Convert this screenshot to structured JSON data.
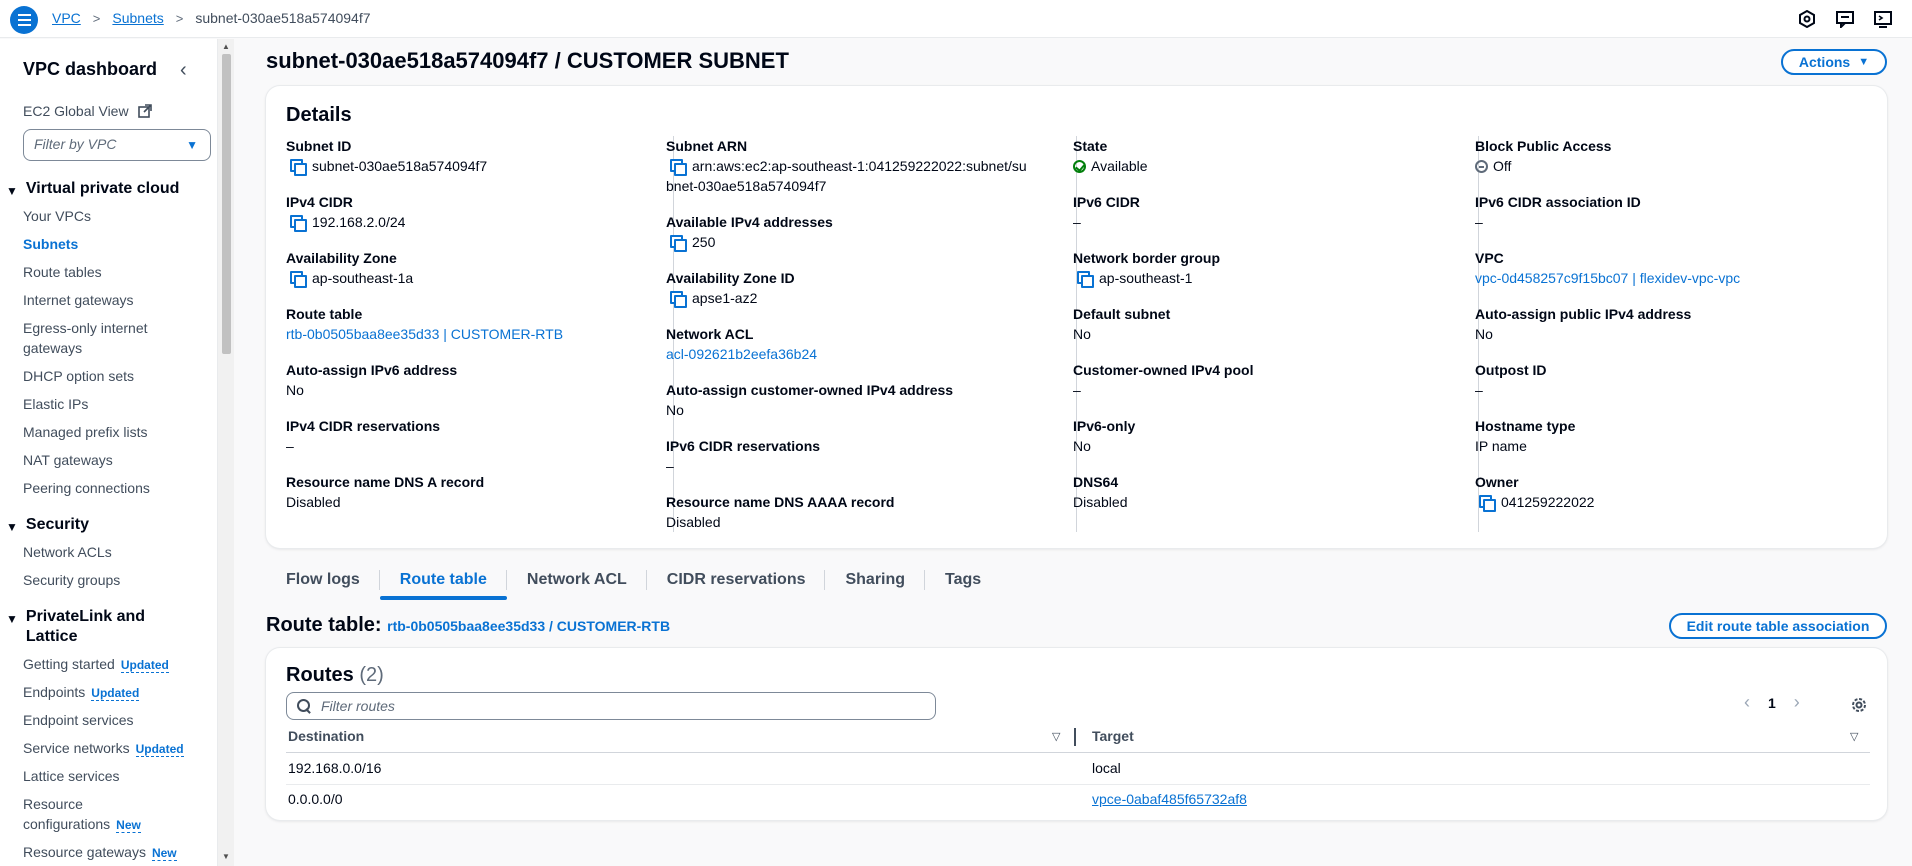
{
  "breadcrumb": {
    "items": [
      "VPC",
      "Subnets"
    ],
    "current": "subnet-030ae518a574094f7"
  },
  "sidebar": {
    "title": "VPC dashboard",
    "ec2_global_view": "EC2 Global View",
    "filter_placeholder": "Filter by VPC",
    "sections": [
      {
        "title": "Virtual private cloud"
      },
      {
        "title": "Security"
      },
      {
        "title": "PrivateLink and Lattice"
      }
    ],
    "vpc_items": [
      "Your VPCs",
      "Subnets",
      "Route tables",
      "Internet gateways",
      "Egress-only internet gateways",
      "DHCP option sets",
      "Elastic IPs",
      "Managed prefix lists",
      "NAT gateways",
      "Peering connections"
    ],
    "security_items": [
      "Network ACLs",
      "Security groups"
    ],
    "privatelink_items": [
      {
        "label": "Getting started",
        "badge": "Updated"
      },
      {
        "label": "Endpoints",
        "badge": "Updated"
      },
      {
        "label": "Endpoint services",
        "badge": ""
      },
      {
        "label": "Service networks",
        "badge": "Updated"
      },
      {
        "label": "Lattice services",
        "badge": ""
      },
      {
        "label": "Resource configurations",
        "badge": "New"
      },
      {
        "label": "Resource gateways",
        "badge": "New"
      }
    ]
  },
  "page": {
    "title": "subnet-030ae518a574094f7 / CUSTOMER SUBNET",
    "actions_label": "Actions"
  },
  "details": {
    "heading": "Details",
    "col1": [
      {
        "key": "Subnet ID",
        "value": "subnet-030ae518a574094f7"
      },
      {
        "key": "IPv4 CIDR",
        "value": "192.168.2.0/24"
      },
      {
        "key": "Availability Zone",
        "value": "ap-southeast-1a"
      },
      {
        "key": "Route table",
        "value": "rtb-0b0505baa8ee35d33 | CUSTOMER-RTB"
      },
      {
        "key": "Auto-assign IPv6 address",
        "value": "No"
      },
      {
        "key": "IPv4 CIDR reservations",
        "value": "–"
      },
      {
        "key": "Resource name DNS A record",
        "value": "Disabled"
      }
    ],
    "col2": [
      {
        "key": "Subnet ARN",
        "value1": "arn:aws:ec2:ap-southeast-1:041259222022:subnet/su",
        "value2": "bnet-030ae518a574094f7"
      },
      {
        "key": "Available IPv4 addresses",
        "value": "250"
      },
      {
        "key": "Availability Zone ID",
        "value": "apse1-az2"
      },
      {
        "key": "Network ACL",
        "value": "acl-092621b2eefa36b24"
      },
      {
        "key": "Auto-assign customer-owned IPv4 address",
        "value": "No"
      },
      {
        "key": "IPv6 CIDR reservations",
        "value": "–"
      },
      {
        "key": "Resource name DNS AAAA record",
        "value": "Disabled"
      }
    ],
    "col3": [
      {
        "key": "State",
        "value": "Available"
      },
      {
        "key": "IPv6 CIDR",
        "value": "–"
      },
      {
        "key": "Network border group",
        "value": "ap-southeast-1"
      },
      {
        "key": "Default subnet",
        "value": "No"
      },
      {
        "key": "Customer-owned IPv4 pool",
        "value": "–"
      },
      {
        "key": "IPv6-only",
        "value": "No"
      },
      {
        "key": "DNS64",
        "value": "Disabled"
      }
    ],
    "col4": [
      {
        "key": "Block Public Access",
        "value": "Off"
      },
      {
        "key": "IPv6 CIDR association ID",
        "value": "–"
      },
      {
        "key": "VPC",
        "value": "vpc-0d458257c9f15bc07 | flexidev-vpc-vpc"
      },
      {
        "key": "Auto-assign public IPv4 address",
        "value": "No"
      },
      {
        "key": "Outpost ID",
        "value": "–"
      },
      {
        "key": "Hostname type",
        "value": "IP name"
      },
      {
        "key": "Owner",
        "value": "041259222022"
      }
    ]
  },
  "tabs": [
    "Flow logs",
    "Route table",
    "Network ACL",
    "CIDR reservations",
    "Sharing",
    "Tags"
  ],
  "route_table": {
    "label": "Route table:",
    "link": "rtb-0b0505baa8ee35d33 / CUSTOMER-RTB",
    "edit_label": "Edit route table association"
  },
  "routes": {
    "title": "Routes",
    "count": "(2)",
    "filter_placeholder": "Filter routes",
    "page": "1",
    "columns": [
      "Destination",
      "Target"
    ],
    "rows": [
      {
        "destination": "192.168.0.0/16",
        "target": "local"
      },
      {
        "destination": "0.0.0.0/0",
        "target": "vpce-0abaf485f65732af8"
      }
    ]
  }
}
